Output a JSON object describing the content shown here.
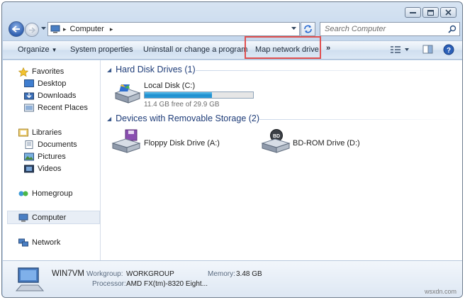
{
  "address": {
    "crumb": "Computer",
    "search_placeholder": "Search Computer"
  },
  "toolbar": {
    "organize": "Organize",
    "system_properties": "System properties",
    "uninstall": "Uninstall or change a program",
    "map_network_drive": "Map network drive",
    "more": "»"
  },
  "nav": {
    "favorites": "Favorites",
    "desktop": "Desktop",
    "downloads": "Downloads",
    "recent_places": "Recent Places",
    "libraries": "Libraries",
    "documents": "Documents",
    "pictures": "Pictures",
    "videos": "Videos",
    "homegroup": "Homegroup",
    "computer": "Computer",
    "network": "Network"
  },
  "groups": {
    "hard_disk": "Hard Disk Drives (1)",
    "removable": "Devices with Removable Storage (2)"
  },
  "drives": {
    "local_disk": {
      "name": "Local Disk (C:)",
      "free_text": "11.4 GB free of 29.9 GB",
      "used_fraction": 0.62
    },
    "floppy": {
      "name": "Floppy Disk Drive (A:)"
    },
    "bdrom": {
      "name": "BD-ROM Drive (D:)",
      "icon_label": "BD"
    }
  },
  "details": {
    "computer_name": "WIN7VM",
    "workgroup_label": "Workgroup:",
    "workgroup_value": "WORKGROUP",
    "memory_label": "Memory:",
    "memory_value": "3.48 GB",
    "processor_label": "Processor:",
    "processor_value": "AMD FX(tm)-8320 Eight..."
  },
  "watermark": "wsxdn.com",
  "colors": {
    "highlight_box": "#e05050",
    "group_header": "#1e3c78",
    "drive_bar": "#2b9ad8"
  }
}
